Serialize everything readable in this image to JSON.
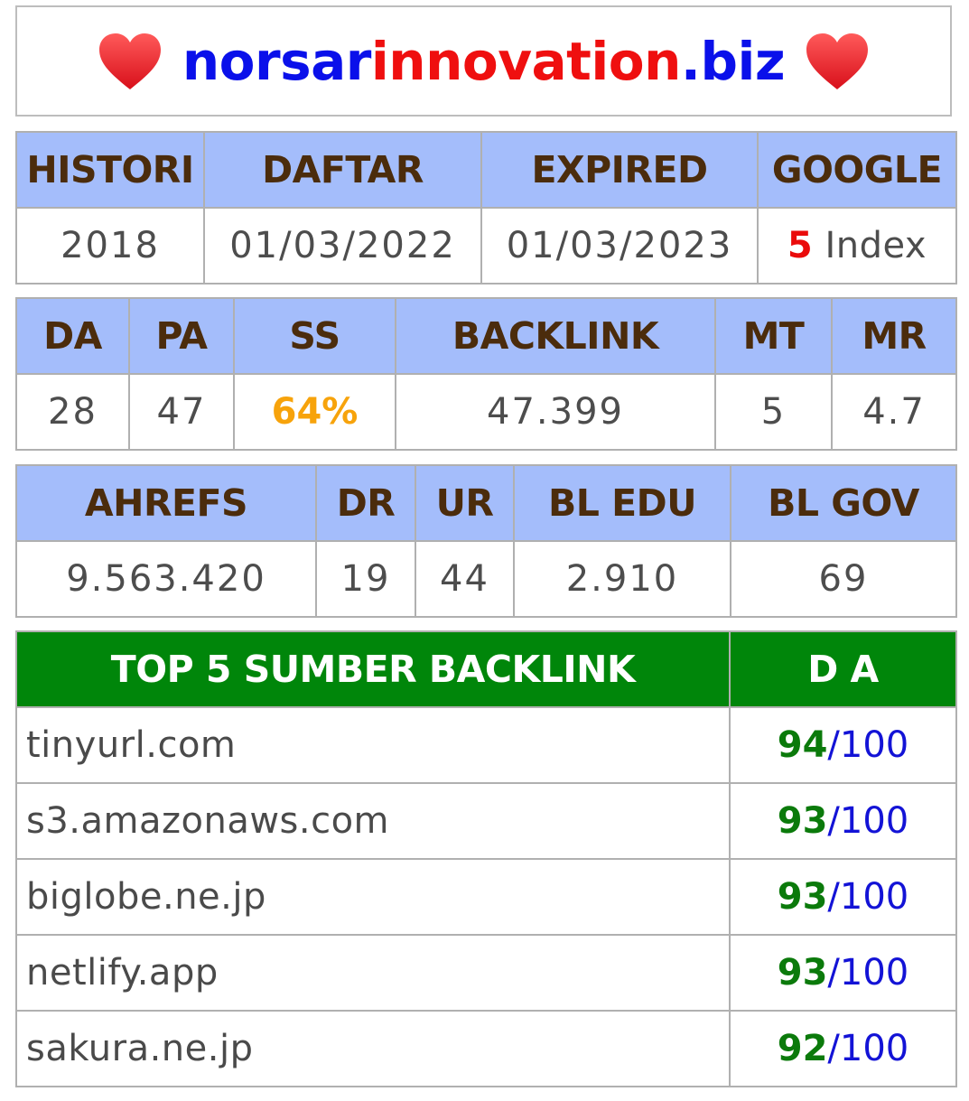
{
  "header": {
    "title_part1": "norsar",
    "title_part2": "innovation",
    "title_part3": ".biz",
    "left_icon": "heart-icon",
    "right_icon": "heart-icon",
    "colors": {
      "blue": "#0a10ea",
      "red": "#ef0f0f"
    }
  },
  "table1": {
    "headers": [
      "HISTORI",
      "DAFTAR",
      "EXPIRED",
      "GOOGLE"
    ],
    "histori": "2018",
    "daftar": "01/03/2022",
    "expired": "01/03/2023",
    "google_count": "5",
    "google_label": "Index"
  },
  "table2": {
    "headers": [
      "DA",
      "PA",
      "SS",
      "BACKLINK",
      "MT",
      "MR"
    ],
    "values": [
      "28",
      "47",
      "64%",
      "47.399",
      "5",
      "4.7"
    ]
  },
  "table3": {
    "headers": [
      "AHREFS",
      "DR",
      "UR",
      "BL EDU",
      "BL GOV"
    ],
    "values": [
      "9.563.420",
      "19",
      "44",
      "2.910",
      "69"
    ]
  },
  "backlinks": {
    "header_source": "TOP 5 SUMBER BACKLINK",
    "header_da": "D A",
    "rows": [
      {
        "site": "tinyurl.com",
        "score": "94",
        "max": "100"
      },
      {
        "site": "s3.amazonaws.com",
        "score": "93",
        "max": "100"
      },
      {
        "site": "biglobe.ne.jp",
        "score": "93",
        "max": "100"
      },
      {
        "site": "netlify.app",
        "score": "93",
        "max": "100"
      },
      {
        "site": "sakura.ne.jp",
        "score": "92",
        "max": "100"
      }
    ],
    "separator": "/"
  }
}
